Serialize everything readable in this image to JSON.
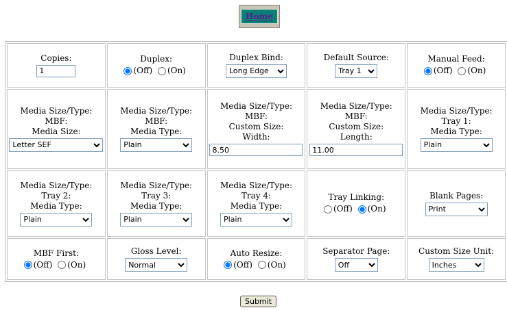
{
  "nav": {
    "home_label": "Home"
  },
  "row1": {
    "copies": {
      "label": "Copies:",
      "value": "1"
    },
    "duplex": {
      "label": "Duplex:",
      "off": "(Off)",
      "on": "(On)",
      "selected": "off"
    },
    "duplex_bind": {
      "label": "Duplex Bind:",
      "value": "Long Edge"
    },
    "default_source": {
      "label": "Default Source:",
      "value": "Tray 1"
    },
    "manual_feed": {
      "label": "Manual Feed:",
      "off": "(Off)",
      "on": "(On)",
      "selected": "off"
    }
  },
  "row2": {
    "mbf_size": {
      "l1": "Media Size/Type:",
      "l2": "MBF:",
      "l3": "Media Size:",
      "value": "Letter SEF"
    },
    "mbf_type": {
      "l1": "Media Size/Type:",
      "l2": "MBF:",
      "l3": "Media Type:",
      "value": "Plain"
    },
    "custom_width": {
      "l1": "Media Size/Type:",
      "l2": "MBF:",
      "l3": "Custom Size:",
      "l4": "Width:",
      "value": "8.50"
    },
    "custom_length": {
      "l1": "Media Size/Type:",
      "l2": "MBF:",
      "l3": "Custom Size:",
      "l4": "Length:",
      "value": "11.00"
    },
    "tray1_type": {
      "l1": "Media Size/Type:",
      "l2": "Tray 1:",
      "l3": "Media Type:",
      "value": "Plain"
    }
  },
  "row3": {
    "tray2_type": {
      "l1": "Media Size/Type:",
      "l2": "Tray 2:",
      "l3": "Media Type:",
      "value": "Plain"
    },
    "tray3_type": {
      "l1": "Media Size/Type:",
      "l2": "Tray 3:",
      "l3": "Media Type:",
      "value": "Plain"
    },
    "tray4_type": {
      "l1": "Media Size/Type:",
      "l2": "Tray 4:",
      "l3": "Media Type:",
      "value": "Plain"
    },
    "tray_linking": {
      "label": "Tray Linking:",
      "off": "(Off)",
      "on": "(On)",
      "selected": "on"
    },
    "blank_pages": {
      "label": "Blank Pages:",
      "value": "Print"
    }
  },
  "row4": {
    "mbf_first": {
      "label": "MBF First:",
      "off": "(Off)",
      "on": "(On)",
      "selected": "off"
    },
    "gloss_level": {
      "label": "Gloss Level:",
      "value": "Normal"
    },
    "auto_resize": {
      "label": "Auto Resize:",
      "off": "(Off)",
      "on": "(On)",
      "selected": "off"
    },
    "separator_page": {
      "label": "Separator Page:",
      "value": "Off"
    },
    "custom_size_unit": {
      "label": "Custom Size Unit:",
      "value": "Inches"
    }
  },
  "submit_label": "Submit"
}
